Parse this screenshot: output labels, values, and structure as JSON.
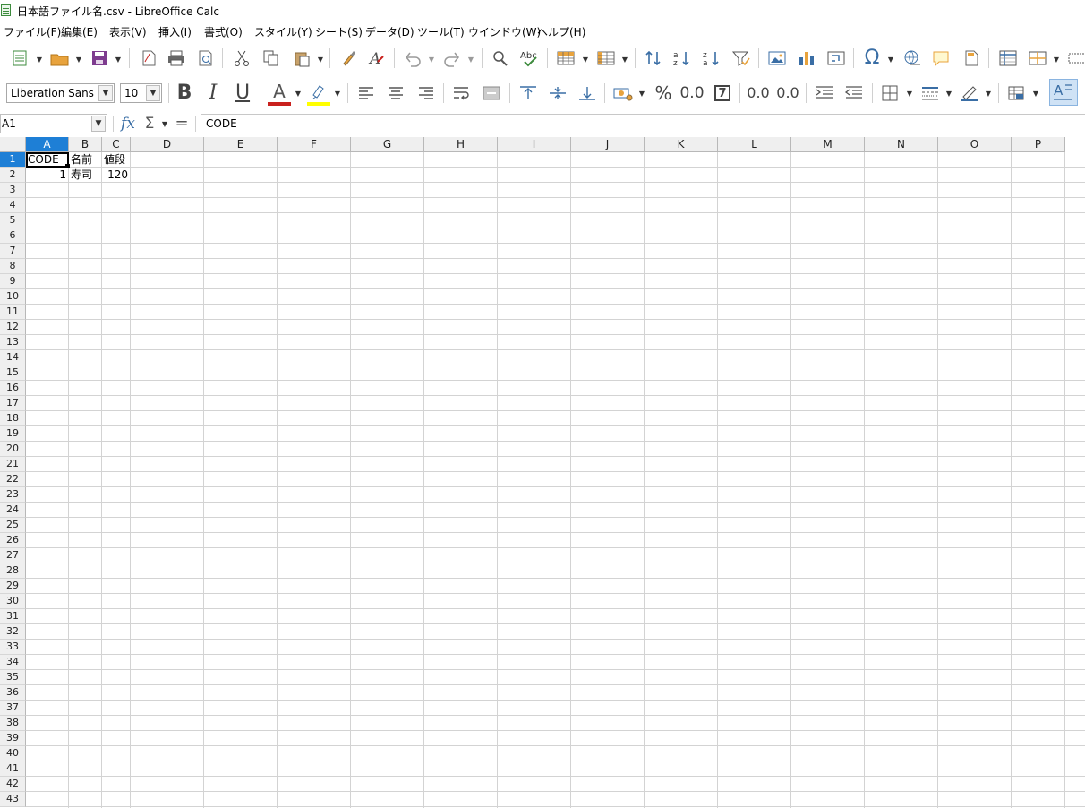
{
  "window": {
    "title": "日本語ファイル名.csv - LibreOffice Calc"
  },
  "menu": [
    "ファイル(F)",
    "編集(E)",
    "表示(V)",
    "挿入(I)",
    "書式(O)",
    "スタイル(Y)",
    "シート(S)",
    "データ(D)",
    "ツール(T)",
    "ウインドウ(W)",
    "ヘルプ(H)"
  ],
  "toolbar1": {
    "icons": [
      "new-icon",
      "open-icon",
      "save-icon",
      "export-pdf-icon",
      "print-icon",
      "print-preview-icon",
      "cut-icon",
      "copy-icon",
      "paste-icon",
      "clone-formatting-icon",
      "clear-formatting-icon",
      "undo-icon",
      "redo-icon",
      "find-replace-icon",
      "spelling-icon",
      "row-icon",
      "column-icon",
      "sort-icon",
      "sort-ascending-icon",
      "sort-descending-icon",
      "autofilter-icon",
      "insert-image-icon",
      "insert-chart-icon",
      "pivot-table-icon",
      "special-character-icon",
      "hyperlink-icon",
      "comment-icon",
      "headers-footers-icon",
      "freeze-rows-icon",
      "split-window-icon",
      "show-draw-functions-icon"
    ]
  },
  "toolbar2": {
    "font_name": "Liberation Sans",
    "font_size": "10",
    "bold_label": "B",
    "italic_label": "I",
    "underline_label": "U",
    "font_color_label": "A",
    "percent_label": "%",
    "number_label": "0.0",
    "date_label": "7",
    "add_decimal_label": "0.0",
    "delete_decimal_label": "0.0",
    "colors": {
      "font_color": "#c9211e",
      "highlight": "#ffff00",
      "accent": "#3a6ea5"
    }
  },
  "formula_bar": {
    "name_box": "A1",
    "function_wizard": "fx",
    "sum_label": "Σ",
    "equals_label": "=",
    "content": "CODE"
  },
  "grid": {
    "columns": [
      "A",
      "B",
      "C",
      "D",
      "E",
      "F",
      "G",
      "H",
      "I",
      "J",
      "K",
      "L",
      "M",
      "N",
      "O",
      "P"
    ],
    "rows": [
      "1",
      "2",
      "3",
      "4",
      "5",
      "6",
      "7",
      "8",
      "9",
      "10",
      "11",
      "12",
      "13",
      "14",
      "15",
      "16",
      "17",
      "18",
      "19",
      "20",
      "21",
      "22",
      "23",
      "24",
      "25",
      "26",
      "27",
      "28",
      "29",
      "30",
      "31",
      "32",
      "33",
      "34",
      "35",
      "36",
      "37",
      "38",
      "39",
      "40",
      "41",
      "42",
      "43"
    ],
    "active_cell": "A1",
    "selection_color": "#1e7fd6",
    "cells": [
      [
        "CODE",
        "名前",
        "値段"
      ],
      [
        "1",
        "寿司",
        "120"
      ]
    ]
  }
}
